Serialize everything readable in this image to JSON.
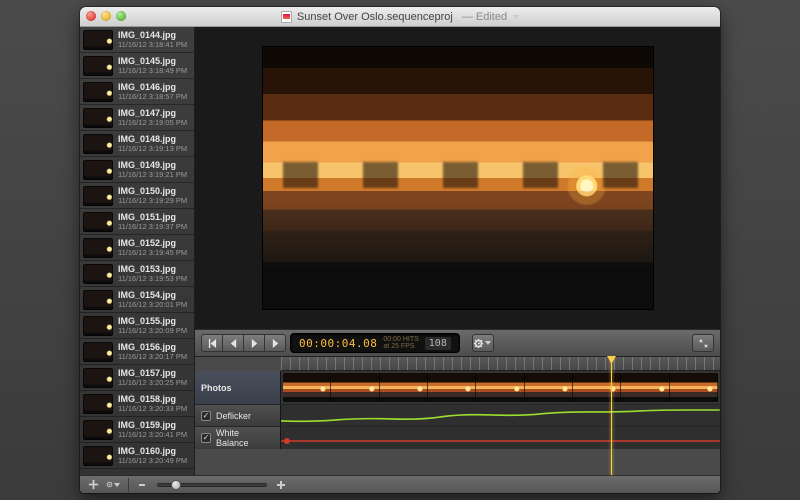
{
  "window": {
    "title": "Sunset Over Oslo.sequenceproj",
    "edited_suffix": "— Edited"
  },
  "files": [
    {
      "name": "IMG_0144.jpg",
      "date": "11/16/12 3:18:41 PM"
    },
    {
      "name": "IMG_0145.jpg",
      "date": "11/16/12 3:18:49 PM"
    },
    {
      "name": "IMG_0146.jpg",
      "date": "11/16/12 3:18:57 PM"
    },
    {
      "name": "IMG_0147.jpg",
      "date": "11/16/12 3:19:05 PM"
    },
    {
      "name": "IMG_0148.jpg",
      "date": "11/16/12 3:19:13 PM"
    },
    {
      "name": "IMG_0149.jpg",
      "date": "11/16/12 3:19:21 PM"
    },
    {
      "name": "IMG_0150.jpg",
      "date": "11/16/12 3:19:29 PM"
    },
    {
      "name": "IMG_0151.jpg",
      "date": "11/16/12 3:19:37 PM"
    },
    {
      "name": "IMG_0152.jpg",
      "date": "11/16/12 3:19:45 PM"
    },
    {
      "name": "IMG_0153.jpg",
      "date": "11/16/12 3:19:53 PM"
    },
    {
      "name": "IMG_0154.jpg",
      "date": "11/16/12 3:20:01 PM"
    },
    {
      "name": "IMG_0155.jpg",
      "date": "11/16/12 3:20:09 PM"
    },
    {
      "name": "IMG_0156.jpg",
      "date": "11/16/12 3:20:17 PM"
    },
    {
      "name": "IMG_0157.jpg",
      "date": "11/16/12 3:20:25 PM"
    },
    {
      "name": "IMG_0158.jpg",
      "date": "11/16/12 3:20:33 PM"
    },
    {
      "name": "IMG_0159.jpg",
      "date": "11/16/12 3:20:41 PM"
    },
    {
      "name": "IMG_0160.jpg",
      "date": "11/16/12 3:20:49 PM"
    }
  ],
  "transport": {
    "timecode": "00:00:04.08",
    "hits_line1": "00:00 HITS",
    "hits_line2": "at 25 FPS",
    "frame": "108"
  },
  "tracks": {
    "photos_label": "Photos",
    "deflicker_label": "Deflicker",
    "whitebalance_label": "White Balance",
    "deflicker_checked": true,
    "whitebalance_checked": true
  },
  "colors": {
    "accent_amber": "#ffbf3d",
    "track_header_blue": "#3f475a"
  }
}
